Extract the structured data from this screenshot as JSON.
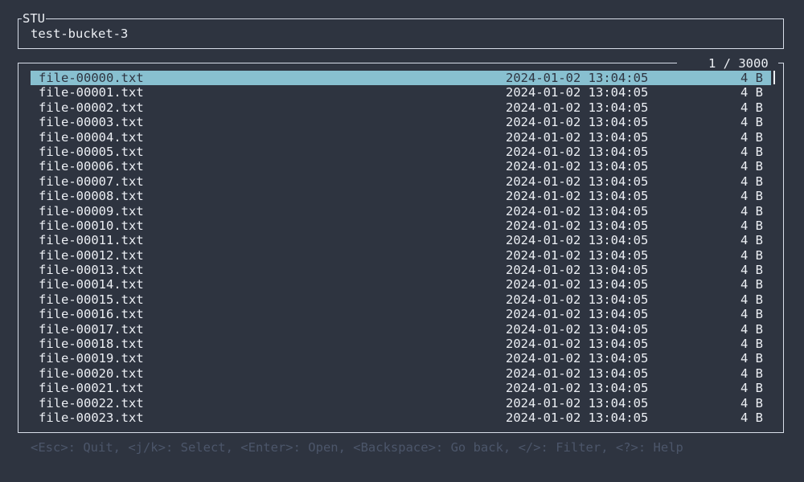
{
  "app": {
    "title": "STU"
  },
  "header": {
    "bucket": "test-bucket-3"
  },
  "list": {
    "counter": "1 / 3000",
    "selected_index": 0,
    "items": [
      {
        "name": "file-00000.txt",
        "date": "2024-01-02 13:04:05",
        "size": "4 B"
      },
      {
        "name": "file-00001.txt",
        "date": "2024-01-02 13:04:05",
        "size": "4 B"
      },
      {
        "name": "file-00002.txt",
        "date": "2024-01-02 13:04:05",
        "size": "4 B"
      },
      {
        "name": "file-00003.txt",
        "date": "2024-01-02 13:04:05",
        "size": "4 B"
      },
      {
        "name": "file-00004.txt",
        "date": "2024-01-02 13:04:05",
        "size": "4 B"
      },
      {
        "name": "file-00005.txt",
        "date": "2024-01-02 13:04:05",
        "size": "4 B"
      },
      {
        "name": "file-00006.txt",
        "date": "2024-01-02 13:04:05",
        "size": "4 B"
      },
      {
        "name": "file-00007.txt",
        "date": "2024-01-02 13:04:05",
        "size": "4 B"
      },
      {
        "name": "file-00008.txt",
        "date": "2024-01-02 13:04:05",
        "size": "4 B"
      },
      {
        "name": "file-00009.txt",
        "date": "2024-01-02 13:04:05",
        "size": "4 B"
      },
      {
        "name": "file-00010.txt",
        "date": "2024-01-02 13:04:05",
        "size": "4 B"
      },
      {
        "name": "file-00011.txt",
        "date": "2024-01-02 13:04:05",
        "size": "4 B"
      },
      {
        "name": "file-00012.txt",
        "date": "2024-01-02 13:04:05",
        "size": "4 B"
      },
      {
        "name": "file-00013.txt",
        "date": "2024-01-02 13:04:05",
        "size": "4 B"
      },
      {
        "name": "file-00014.txt",
        "date": "2024-01-02 13:04:05",
        "size": "4 B"
      },
      {
        "name": "file-00015.txt",
        "date": "2024-01-02 13:04:05",
        "size": "4 B"
      },
      {
        "name": "file-00016.txt",
        "date": "2024-01-02 13:04:05",
        "size": "4 B"
      },
      {
        "name": "file-00017.txt",
        "date": "2024-01-02 13:04:05",
        "size": "4 B"
      },
      {
        "name": "file-00018.txt",
        "date": "2024-01-02 13:04:05",
        "size": "4 B"
      },
      {
        "name": "file-00019.txt",
        "date": "2024-01-02 13:04:05",
        "size": "4 B"
      },
      {
        "name": "file-00020.txt",
        "date": "2024-01-02 13:04:05",
        "size": "4 B"
      },
      {
        "name": "file-00021.txt",
        "date": "2024-01-02 13:04:05",
        "size": "4 B"
      },
      {
        "name": "file-00022.txt",
        "date": "2024-01-02 13:04:05",
        "size": "4 B"
      },
      {
        "name": "file-00023.txt",
        "date": "2024-01-02 13:04:05",
        "size": "4 B"
      }
    ]
  },
  "footer": {
    "help": "<Esc>: Quit, <j/k>: Select, <Enter>: Open, <Backspace>: Go back, </>: Filter, <?>: Help"
  },
  "colors": {
    "background": "#2e3440",
    "foreground": "#eceff4",
    "border": "#d8dee9",
    "selection": "#88c0d0",
    "muted": "#4c566a"
  }
}
